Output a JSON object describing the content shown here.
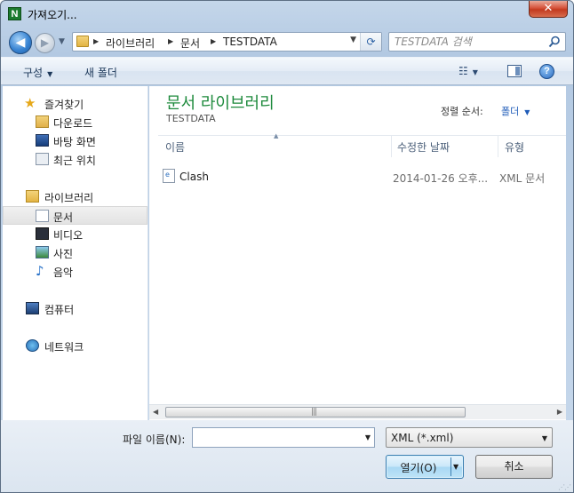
{
  "window": {
    "title": "가져오기...",
    "app_icon_letter": "N",
    "close_glyph": "✕"
  },
  "nav": {
    "back_glyph": "◀",
    "forward_glyph": "▶",
    "breadcrumbs": [
      "라이브러리",
      "문서",
      "TESTDATA"
    ],
    "refresh_glyph": "⟳"
  },
  "search": {
    "placeholder": "TESTDATA 검색"
  },
  "commandbar": {
    "organize_label": "구성",
    "new_folder_label": "새 폴더",
    "view_glyph": "☷",
    "help_glyph": "?"
  },
  "sidebar": {
    "favorites_header": "즐겨찾기",
    "favorites": [
      "다운로드",
      "바탕 화면",
      "최근 위치"
    ],
    "libraries_header": "라이브러리",
    "libraries": [
      "문서",
      "비디오",
      "사진",
      "음악"
    ],
    "selected": "문서",
    "computer_label": "컴퓨터",
    "network_label": "네트워크"
  },
  "library": {
    "title": "문서 라이브러리",
    "subtitle": "TESTDATA",
    "sort_label": "정렬 순서:",
    "sort_value": "폴더"
  },
  "columns": {
    "name": "이름",
    "modified": "수정한 날짜",
    "type": "유형"
  },
  "files": [
    {
      "name": "Clash",
      "modified": "2014-01-26 오후...",
      "type": "XML 문서"
    }
  ],
  "bottom": {
    "filename_label": "파일 이름(N):",
    "filename_value": "",
    "filetype_value": "XML (*.xml)",
    "open_label": "열기(O)",
    "cancel_label": "취소"
  }
}
